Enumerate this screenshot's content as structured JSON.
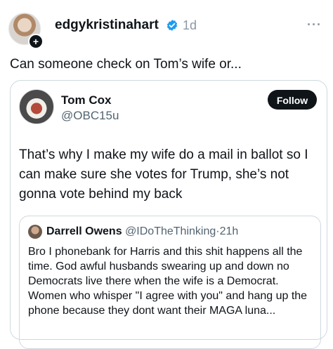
{
  "post": {
    "author": "edgykristinahart",
    "time": "1d",
    "text": "Can someone check on Tom’s wife or..."
  },
  "quote": {
    "name": "Tom Cox",
    "handle": "@OBC15u",
    "follow_label": "Follow",
    "text": "That’s why I make my wife do a mail in ballot so I can make sure she votes for Trump, she’s not gonna vote behind my back"
  },
  "nested": {
    "name": "Darrell Owens",
    "handle": "@IDoTheThinking",
    "separator": "·",
    "time": "21h",
    "text": "Bro I phonebank for Harris and this shit happens all the time. God awful husbands swearing up and down no Democrats live there when the wife is a Democrat. Women who whisper \"I agree with you\" and hang up the phone because they dont want their MAGA luna..."
  },
  "icons": {
    "verified": "verified-badge-icon",
    "more": "more-options-icon",
    "plus": "follow-plus-icon"
  },
  "colors": {
    "verified": "#1d9bf0",
    "muted": "#536471",
    "border": "#cfd9de"
  }
}
